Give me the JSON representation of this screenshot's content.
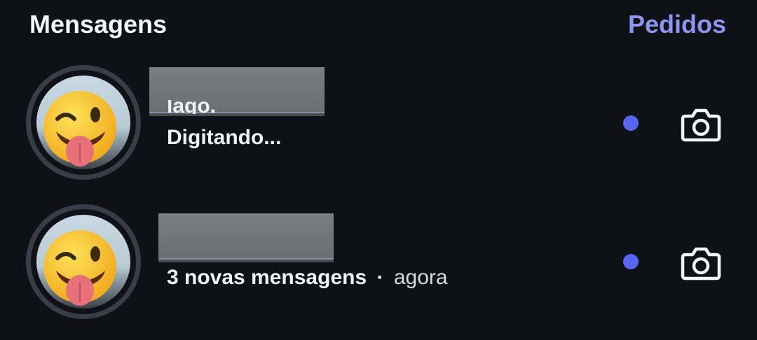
{
  "header": {
    "title": "Mensagens",
    "requests_label": "Pedidos",
    "requests_color": "#8b94ee"
  },
  "threads": [
    {
      "avatar_icon": "winking-tongue-emoji-avatar",
      "name_redacted": true,
      "peek_text": "lago.",
      "status_text": "Digitando...",
      "unread_dot_color": "#5865f2",
      "camera_icon": "camera-icon"
    },
    {
      "avatar_icon": "winking-tongue-emoji-avatar",
      "name_redacted": true,
      "status_text": "3 novas mensagens",
      "separator": "·",
      "time_text": "agora",
      "unread_dot_color": "#5865f2",
      "camera_icon": "camera-icon"
    }
  ]
}
